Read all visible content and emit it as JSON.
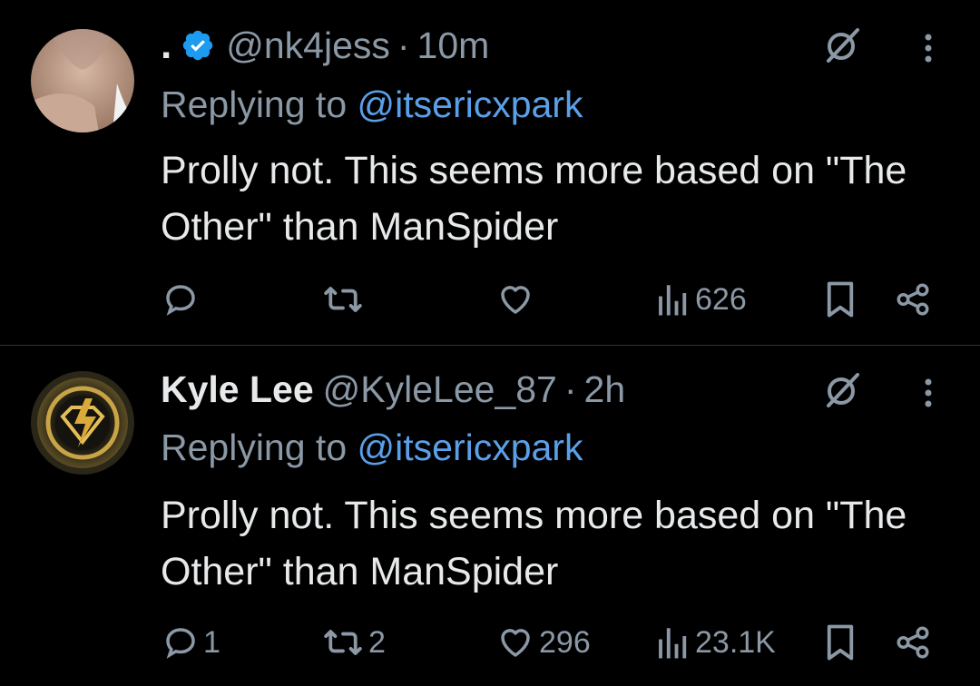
{
  "tweets": [
    {
      "display_name": ".",
      "handle": "@nk4jess",
      "separator": "·",
      "time": "10m",
      "reply_prefix": "Replying to ",
      "reply_mention": "@itsericxpark",
      "text": "Prolly not. This seems more based on \"The Other\" than ManSpider",
      "views": "626",
      "verified": true
    },
    {
      "display_name": "Kyle Lee",
      "handle": "@KyleLee_87",
      "separator": "·",
      "time": "2h",
      "reply_prefix": "Replying to ",
      "reply_mention": "@itsericxpark",
      "text": "Prolly not. This seems more based on \"The Other\" than ManSpider",
      "replies": "1",
      "retweets": "2",
      "likes": "296",
      "views": "23.1K"
    }
  ],
  "colors": {
    "background": "#000000",
    "text": "#e7e9ea",
    "muted": "#8b98a5",
    "link": "#5aa0e8",
    "verified": "#1d9bf0"
  }
}
